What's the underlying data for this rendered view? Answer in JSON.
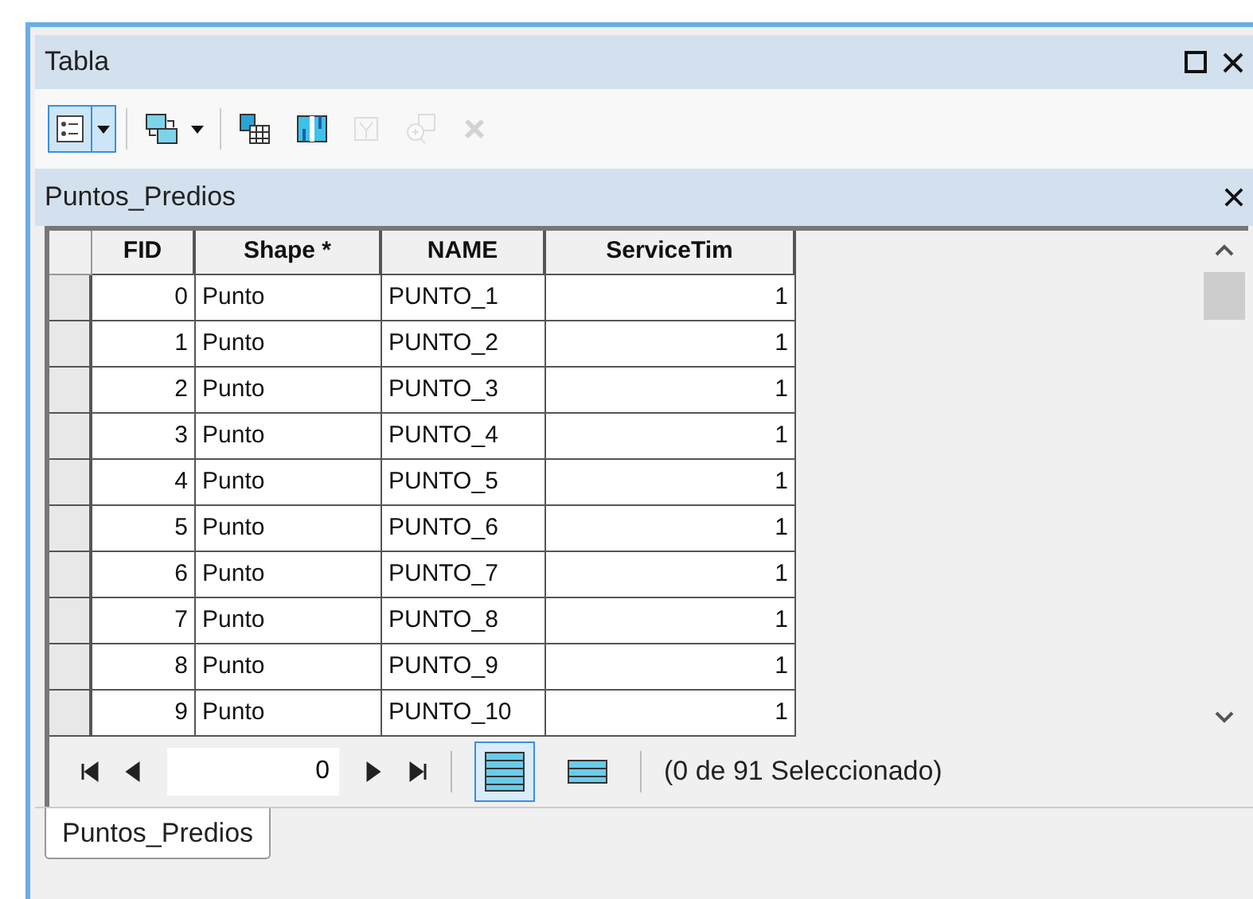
{
  "window": {
    "title": "Tabla"
  },
  "toolbar": [
    {
      "kind": "options",
      "disabled": false,
      "selected": true,
      "dropdown": true
    },
    {
      "kind": "related",
      "disabled": false,
      "selected": false,
      "dropdown": true
    },
    {
      "kind": "select-attributes",
      "disabled": false,
      "selected": false,
      "dropdown": false
    },
    {
      "kind": "switch-selection",
      "disabled": false,
      "selected": false,
      "dropdown": false
    },
    {
      "kind": "clear-selection",
      "disabled": true,
      "selected": false,
      "dropdown": false
    },
    {
      "kind": "zoom-selected",
      "disabled": true,
      "selected": false,
      "dropdown": false
    },
    {
      "kind": "delete",
      "disabled": true,
      "selected": false,
      "dropdown": false
    }
  ],
  "table_title": "Puntos_Predios",
  "table": {
    "columns": [
      "FID",
      "Shape *",
      "NAME",
      "ServiceTim"
    ],
    "rows": [
      [
        "0",
        "Punto",
        "PUNTO_1",
        "1"
      ],
      [
        "1",
        "Punto",
        "PUNTO_2",
        "1"
      ],
      [
        "2",
        "Punto",
        "PUNTO_3",
        "1"
      ],
      [
        "3",
        "Punto",
        "PUNTO_4",
        "1"
      ],
      [
        "4",
        "Punto",
        "PUNTO_5",
        "1"
      ],
      [
        "5",
        "Punto",
        "PUNTO_6",
        "1"
      ],
      [
        "6",
        "Punto",
        "PUNTO_7",
        "1"
      ],
      [
        "7",
        "Punto",
        "PUNTO_8",
        "1"
      ],
      [
        "8",
        "Punto",
        "PUNTO_9",
        "1"
      ],
      [
        "9",
        "Punto",
        "PUNTO_10",
        "1"
      ]
    ]
  },
  "navigation": {
    "record": "0",
    "views": [
      {
        "kind": "all",
        "selected": true
      },
      {
        "kind": "selected",
        "selected": false
      }
    ],
    "status": "(0 de 91 Seleccionado)"
  },
  "tabs": [
    {
      "label": "Puntos_Predios",
      "selected": true
    }
  ]
}
